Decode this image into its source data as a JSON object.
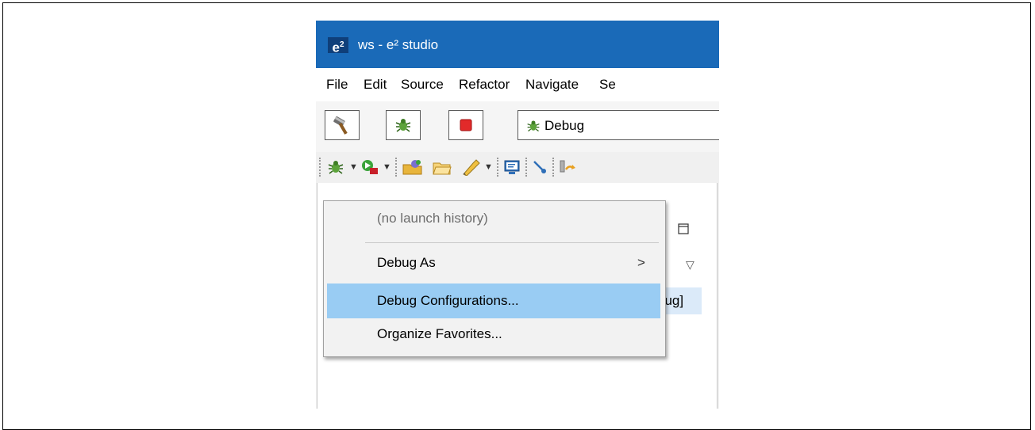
{
  "window": {
    "logo": "e",
    "logo_sup": "2",
    "title": "ws - e² studio"
  },
  "menu": [
    "File",
    "Edit",
    "Source",
    "Refactor",
    "Navigate",
    "Se"
  ],
  "toolbar": {
    "build_icon": "hammer-icon",
    "debug_icon": "bug-icon",
    "stop_icon": "stop-icon",
    "launch_config": "Debug"
  },
  "toolbar2_icons": [
    "debug-icon",
    "run-icon",
    "open-type-icon",
    "open-folder-icon",
    "tool-icon",
    "console-icon",
    "link-icon",
    "overlay-icon"
  ],
  "editor": {
    "selected_fragment": "bug]"
  },
  "popup": {
    "items": [
      {
        "label": "(no launch history)",
        "disabled": true
      },
      {
        "label": "Debug As",
        "submenu": true
      },
      {
        "label": "Debug Configurations...",
        "highlighted": true
      },
      {
        "label": "Organize Favorites..."
      }
    ],
    "submenu_glyph": ">"
  },
  "colors": {
    "titlebar": "#1a6ab8",
    "highlight": "#99ccf3",
    "stop": "#e22a2a"
  }
}
